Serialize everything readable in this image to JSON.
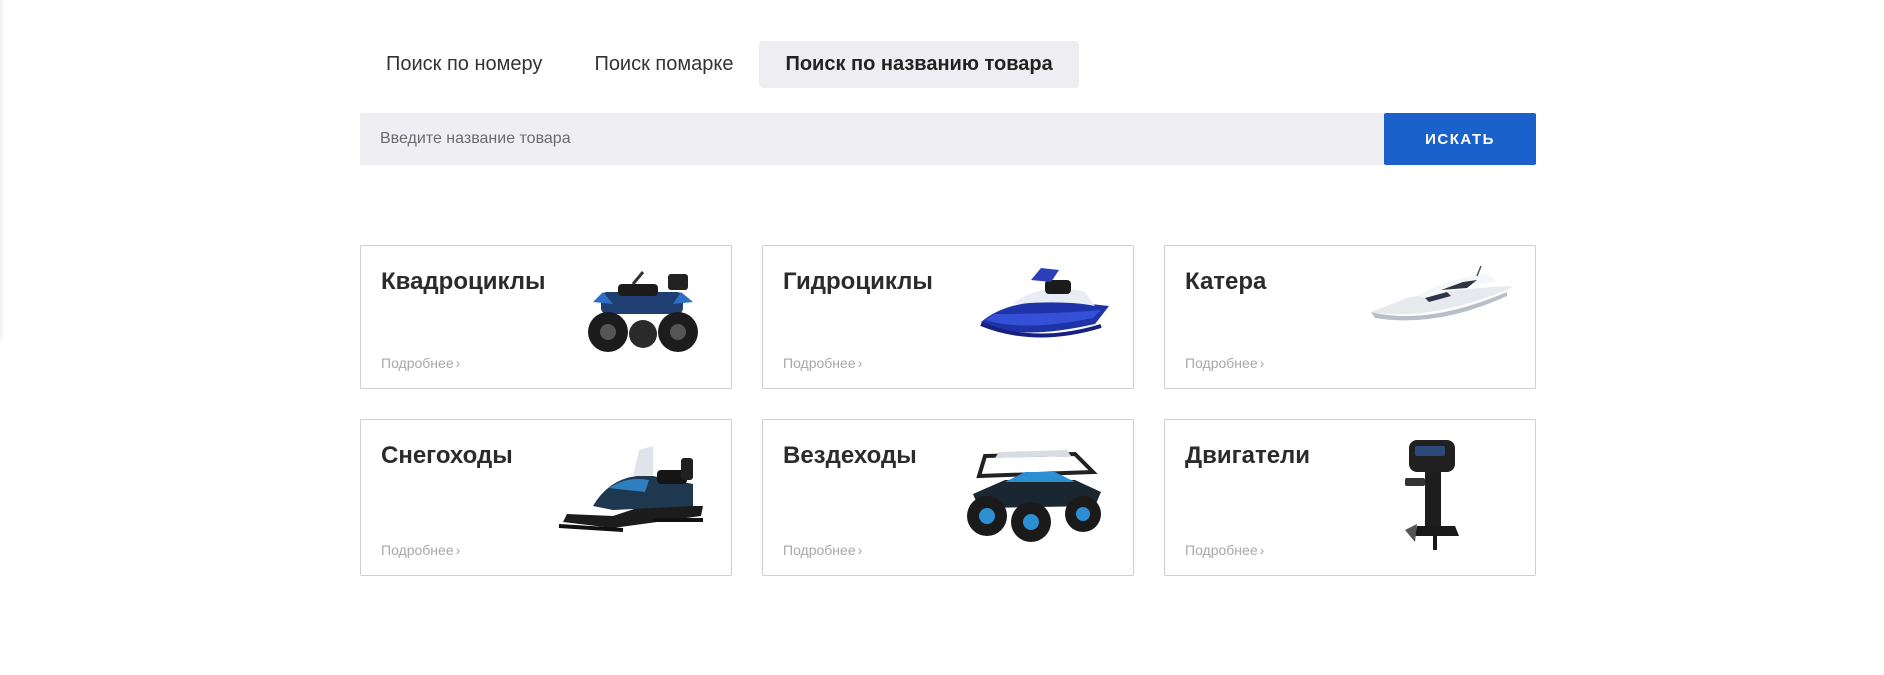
{
  "tabs": [
    {
      "label": "Поиск по номеру",
      "active": false
    },
    {
      "label": "Поиск помарке",
      "active": false
    },
    {
      "label": "Поиск по названию товара",
      "active": true
    }
  ],
  "search": {
    "placeholder": "Введите название товара",
    "button_label": "ИСКАТЬ"
  },
  "categories": [
    {
      "title": "Квадроциклы",
      "more": "Подробнее",
      "icon": "atv-image"
    },
    {
      "title": "Гидроциклы",
      "more": "Подробнее",
      "icon": "jetski-image"
    },
    {
      "title": "Катера",
      "more": "Подробнее",
      "icon": "boat-image"
    },
    {
      "title": "Снегоходы",
      "more": "Подробнее",
      "icon": "snowmobile-image"
    },
    {
      "title": "Вездеходы",
      "more": "Подробнее",
      "icon": "utv-image"
    },
    {
      "title": "Двигатели",
      "more": "Подробнее",
      "icon": "outboard-motor-image"
    }
  ],
  "colors": {
    "accent": "#1a61cb",
    "tab_active_bg": "#eeeef2",
    "input_bg": "#efeff3"
  }
}
